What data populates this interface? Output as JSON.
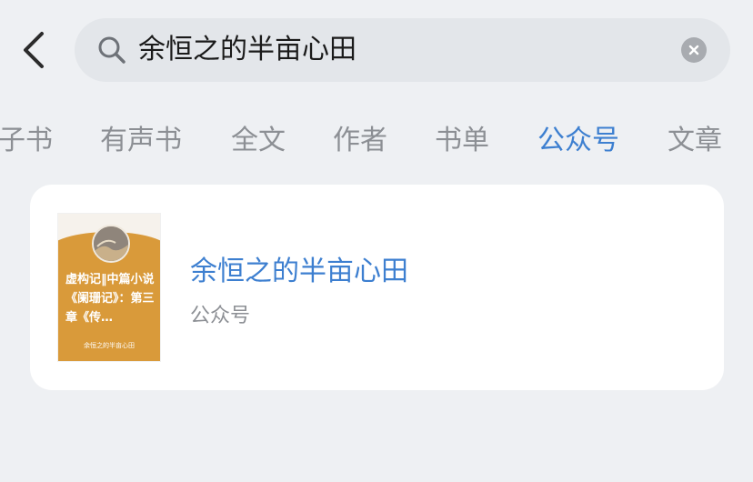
{
  "search": {
    "query": "余恒之的半亩心田"
  },
  "tabs": [
    {
      "label": "子书"
    },
    {
      "label": "有声书"
    },
    {
      "label": "全文"
    },
    {
      "label": "作者"
    },
    {
      "label": "书单"
    },
    {
      "label": "公众号"
    },
    {
      "label": "文章"
    }
  ],
  "active_tab": "公众号",
  "result": {
    "title": "余恒之的半亩心田",
    "type": "公众号",
    "cover": {
      "title": "虚构记‖中篇小说《阑珊记》：第三章《传…",
      "footer": "余恒之的半亩心田",
      "color": "#d99a3a"
    }
  },
  "colors": {
    "accent": "#3d7fd0",
    "muted_text": "#8c8f94",
    "background": "#eef0f3"
  },
  "icons": [
    "back-icon",
    "search-icon",
    "clear-icon"
  ]
}
